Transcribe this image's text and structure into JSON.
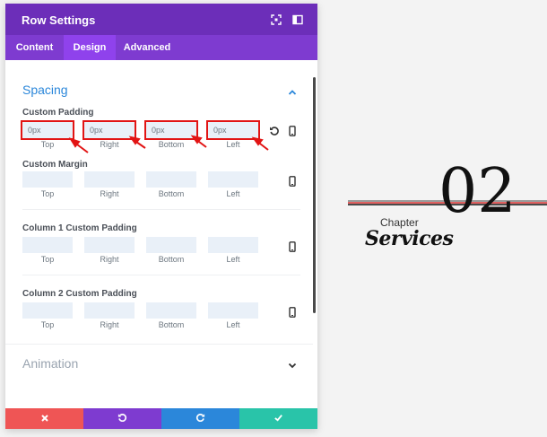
{
  "panel": {
    "title": "Row Settings",
    "tabs": [
      {
        "label": "Content",
        "active": false
      },
      {
        "label": "Design",
        "active": true
      },
      {
        "label": "Advanced",
        "active": false
      }
    ],
    "spacing": {
      "title": "Spacing",
      "groups": [
        {
          "label": "Custom Padding",
          "values": [
            "0px",
            "0px",
            "0px",
            "0px"
          ],
          "highlighted": true
        },
        {
          "label": "Custom Margin",
          "values": [
            "",
            "",
            "",
            ""
          ],
          "highlighted": false
        },
        {
          "label": "Column 1 Custom Padding",
          "values": [
            "",
            "",
            "",
            ""
          ],
          "highlighted": false
        },
        {
          "label": "Column 2 Custom Padding",
          "values": [
            "",
            "",
            "",
            ""
          ],
          "highlighted": false
        }
      ],
      "sides": [
        "Top",
        "Right",
        "Bottom",
        "Left"
      ]
    },
    "animation": {
      "title": "Animation"
    },
    "footer": {
      "colors": {
        "cancel": "#ef5555",
        "undo": "#7e3bd0",
        "redo": "#2b87da",
        "save": "#29c4a9"
      }
    }
  },
  "colors": {
    "header": "#6c2eb9",
    "tabs": "#7e3bd0",
    "active_tab": "#8f42ec",
    "accent": "#2b87da",
    "highlight": "#e21414"
  },
  "preview": {
    "chapter": "Chapter",
    "services": "Services",
    "number": "02"
  }
}
